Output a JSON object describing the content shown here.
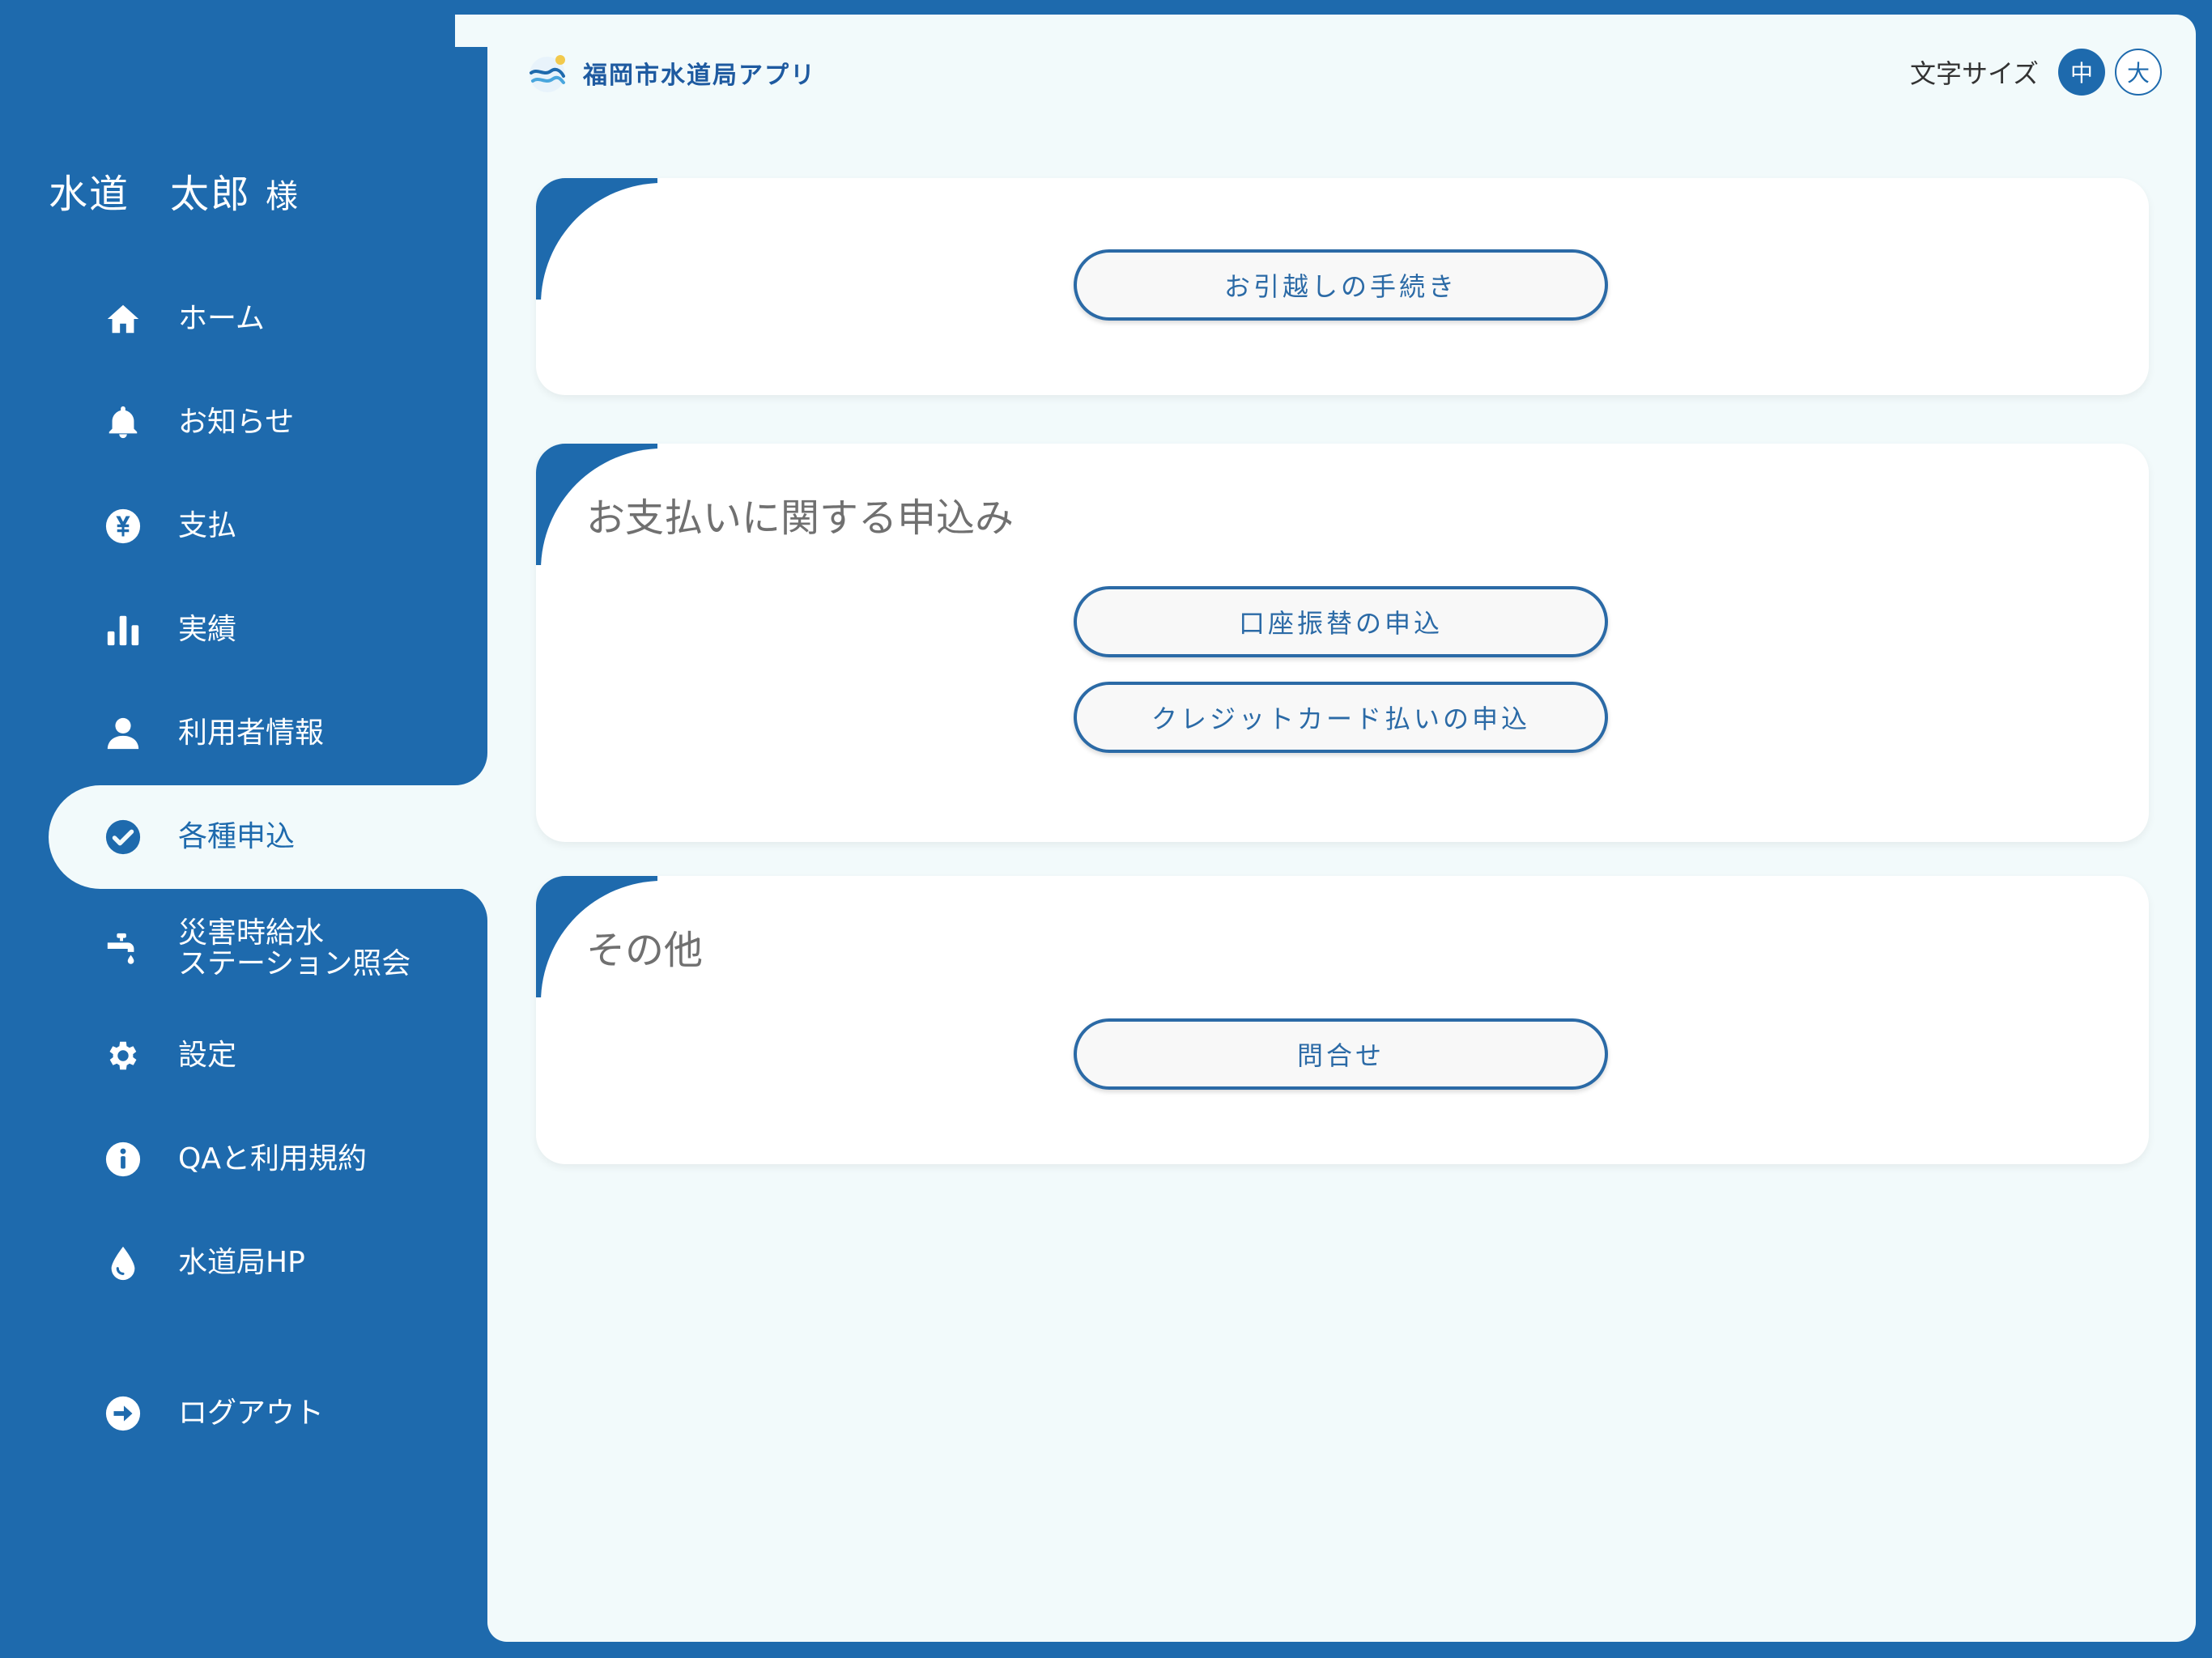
{
  "user": {
    "name": "水道　太郎",
    "honorific": "様"
  },
  "sidebar": {
    "items": [
      {
        "label": "ホーム",
        "icon": "home-icon"
      },
      {
        "label": "お知らせ",
        "icon": "bell-icon"
      },
      {
        "label": "支払",
        "icon": "yen-icon"
      },
      {
        "label": "実績",
        "icon": "bar-chart-icon"
      },
      {
        "label": "利用者情報",
        "icon": "user-icon"
      },
      {
        "label": "各種申込",
        "icon": "check-circle-icon",
        "active": true
      },
      {
        "label": "災害時給水\nステーション照会",
        "icon": "faucet-icon"
      },
      {
        "label": "設定",
        "icon": "gear-icon"
      },
      {
        "label": "QAと利用規約",
        "icon": "info-icon"
      },
      {
        "label": "水道局HP",
        "icon": "water-drop-icon"
      },
      {
        "label": "ログアウト",
        "icon": "logout-icon"
      }
    ]
  },
  "header": {
    "app_title": "福岡市水道局アプリ",
    "font_size_label": "文字サイズ",
    "font_size_medium": "中",
    "font_size_large": "大"
  },
  "cards": {
    "moving": {
      "button": "お引越しの手続き"
    },
    "payment": {
      "title": "お支払いに関する申込み",
      "button_account": "口座振替の申込",
      "button_credit": "クレジットカード払いの申込"
    },
    "other": {
      "title": "その他",
      "button_inquiry": "問合せ"
    }
  },
  "colors": {
    "primary": "#1e6aad",
    "background": "#f2fafb",
    "card": "#ffffff",
    "title_gray": "#707070"
  }
}
